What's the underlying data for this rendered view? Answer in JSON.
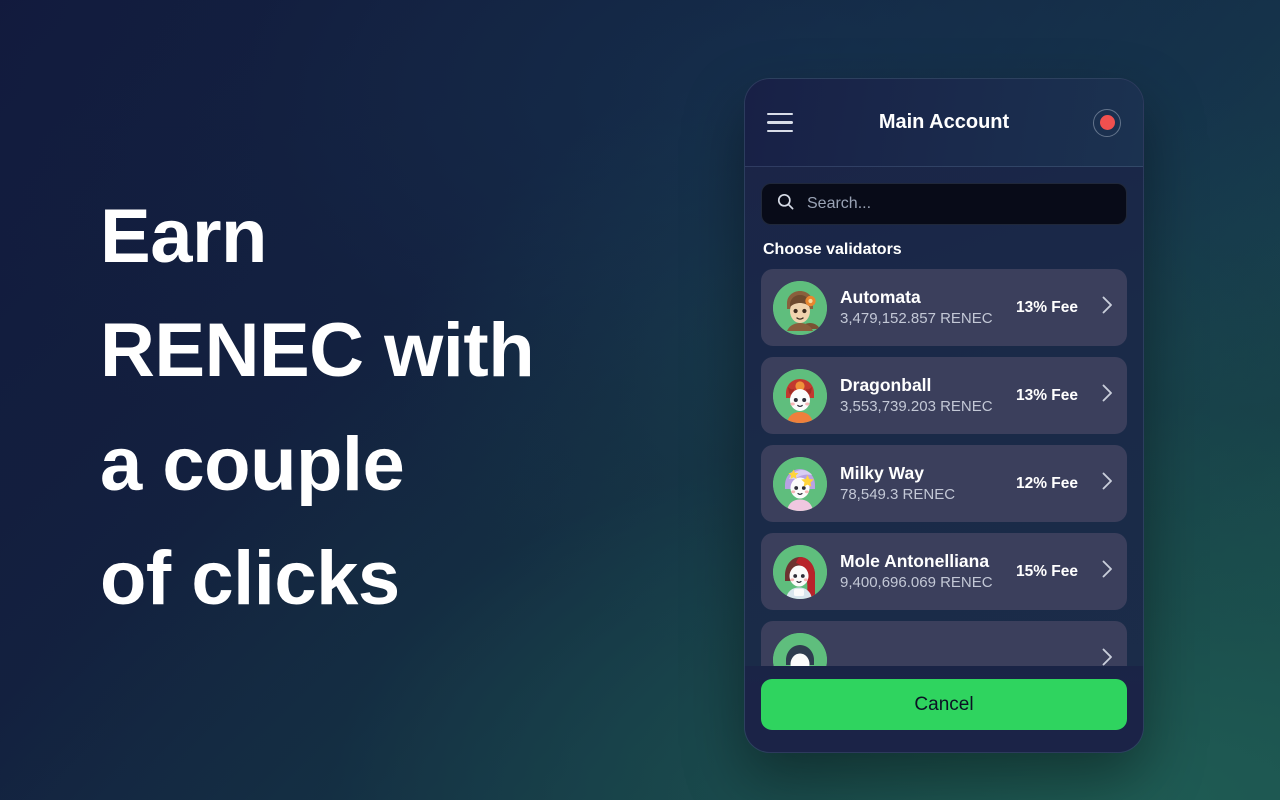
{
  "hero": {
    "lines": [
      "Earn",
      "RENEC with",
      "a couple",
      "of clicks"
    ]
  },
  "colors": {
    "accent_green": "#2fd45f",
    "status_red": "#f0504f",
    "card_bg": "#3b3f5c",
    "bg_navy": "#121a3d",
    "bg_teal": "#1c5a52"
  },
  "phone": {
    "header": {
      "menu_icon": "hamburger-icon",
      "title": "Main Account",
      "status_icon": "record-dot-icon"
    },
    "search": {
      "icon": "search-icon",
      "placeholder": "Search...",
      "value": ""
    },
    "section_label": "Choose validators",
    "validators": [
      {
        "avatar": "avatar-automata",
        "name": "Automata",
        "amount": "3,479,152.857 RENEC",
        "fee": "13% Fee",
        "chevron": "chevron-right-icon"
      },
      {
        "avatar": "avatar-dragonball",
        "name": "Dragonball",
        "amount": "3,553,739.203 RENEC",
        "fee": "13% Fee",
        "chevron": "chevron-right-icon"
      },
      {
        "avatar": "avatar-milky-way",
        "name": "Milky Way",
        "amount": "78,549.3 RENEC",
        "fee": "12% Fee",
        "chevron": "chevron-right-icon"
      },
      {
        "avatar": "avatar-mole-antonelliana",
        "name": "Mole Antonelliana",
        "amount": "9,400,696.069 RENEC",
        "fee": "15% Fee",
        "chevron": "chevron-right-icon"
      },
      {
        "avatar": "avatar-partial",
        "name": "",
        "amount": "",
        "fee": "",
        "chevron": "chevron-right-icon"
      }
    ],
    "footer": {
      "cancel_label": "Cancel"
    }
  }
}
